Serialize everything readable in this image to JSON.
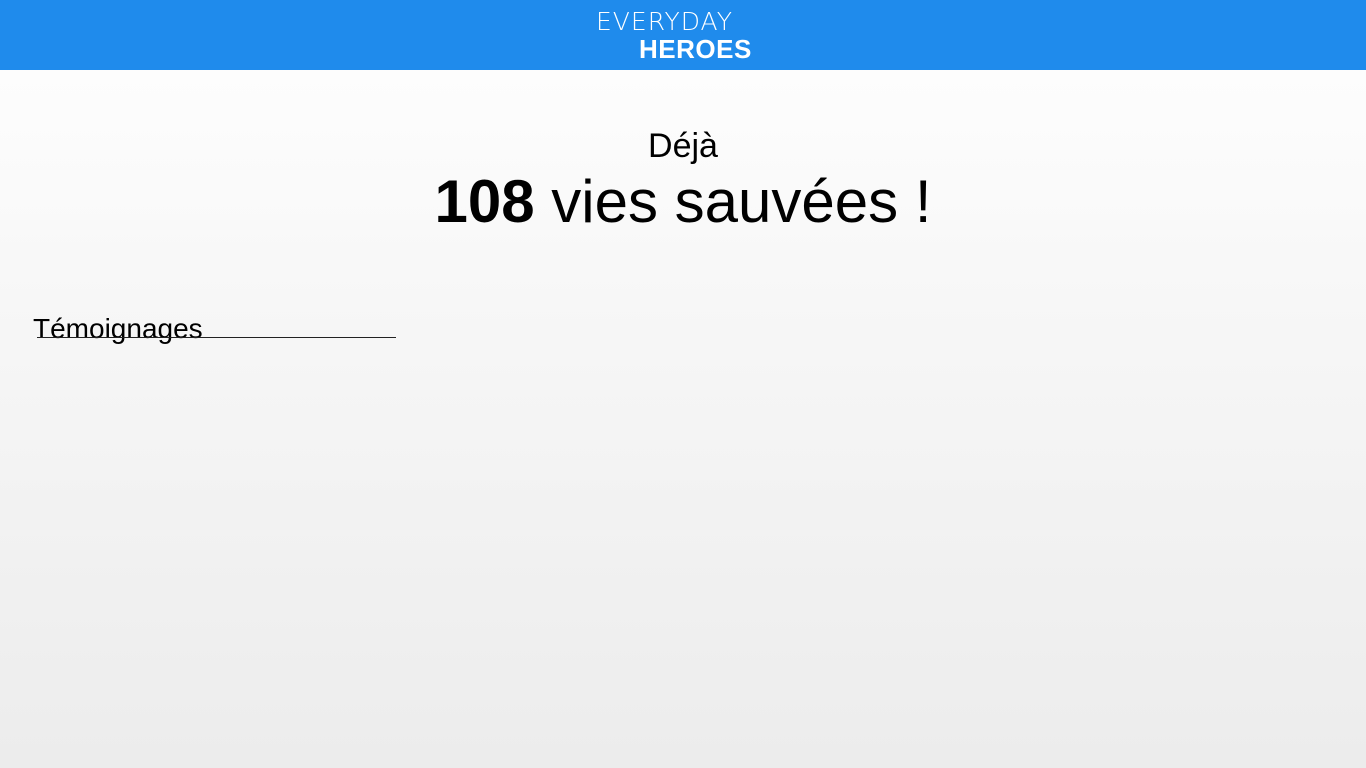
{
  "header": {
    "logo_line1": "EVERYDAY",
    "logo_line2": "HEROES",
    "background_color": "#1f8bec"
  },
  "counter": {
    "prefix": "Déjà",
    "number": "108",
    "suffix": "vies sauvées !"
  },
  "testimonials": {
    "heading": "Témoignages"
  }
}
